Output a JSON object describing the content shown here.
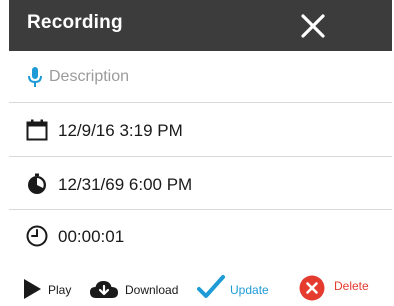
{
  "header": {
    "title": "Recording",
    "close_icon": "close-icon"
  },
  "description": {
    "placeholder": "Description",
    "value": "",
    "icon": "microphone-icon"
  },
  "fields": {
    "date_created": "12/9/16 3:19 PM",
    "date_modified": "12/31/69 6:00 PM",
    "duration": "00:00:01"
  },
  "icons": {
    "date_created": "calendar-icon",
    "date_modified": "timer-icon",
    "duration": "clock-icon"
  },
  "actions": {
    "play": "Play",
    "download": "Download",
    "update": "Update",
    "delete": "Delete"
  },
  "colors": {
    "header_bg": "#3c3c3c",
    "accent_blue": "#1e9bd7",
    "delete_red": "#e53b2f",
    "placeholder_gray": "#9b9b9b"
  }
}
